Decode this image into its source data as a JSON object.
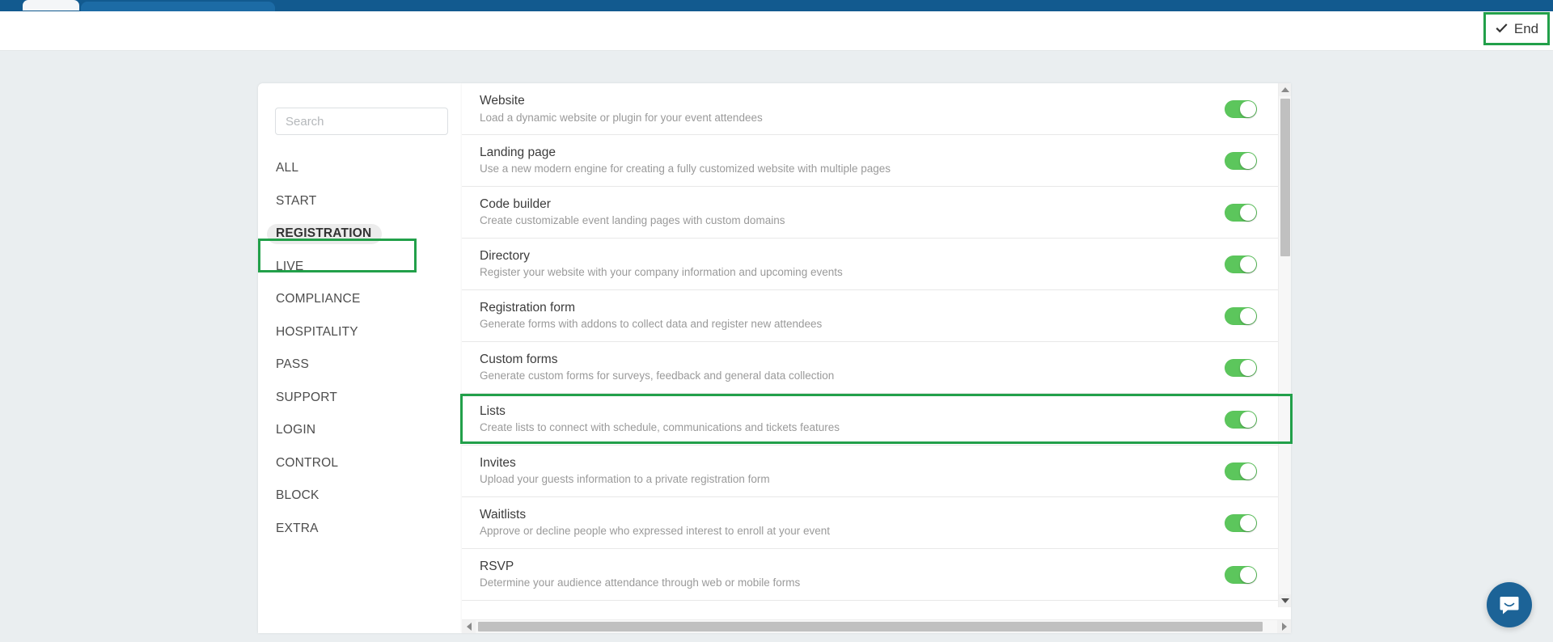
{
  "browser": {
    "chrome_color": "#125a8f",
    "active_tab_color": "#1c6ba5"
  },
  "header": {
    "end_button_label": "End",
    "end_button_icon": "check-icon",
    "highlight_color": "#22a04a"
  },
  "sidebar": {
    "search": {
      "value": "",
      "placeholder": "Search"
    },
    "items": [
      {
        "label": "ALL",
        "selected": false
      },
      {
        "label": "START",
        "selected": false
      },
      {
        "label": "REGISTRATION",
        "selected": true
      },
      {
        "label": "LIVE",
        "selected": false
      },
      {
        "label": "COMPLIANCE",
        "selected": false
      },
      {
        "label": "HOSPITALITY",
        "selected": false
      },
      {
        "label": "PASS",
        "selected": false
      },
      {
        "label": "SUPPORT",
        "selected": false
      },
      {
        "label": "LOGIN",
        "selected": false
      },
      {
        "label": "CONTROL",
        "selected": false
      },
      {
        "label": "BLOCK",
        "selected": false
      },
      {
        "label": "EXTRA",
        "selected": false
      }
    ]
  },
  "features": {
    "rows": [
      {
        "title": "Website",
        "description": "Load a dynamic website or plugin for your event attendees",
        "toggle": "on",
        "highlighted": false
      },
      {
        "title": "Landing page",
        "description": "Use a new modern engine for creating a fully customized website with multiple pages",
        "toggle": "on",
        "highlighted": false
      },
      {
        "title": "Code builder",
        "description": "Create customizable event landing pages with custom domains",
        "toggle": "on",
        "highlighted": false
      },
      {
        "title": "Directory",
        "description": "Register your website with your company information and upcoming events",
        "toggle": "on",
        "highlighted": false
      },
      {
        "title": "Registration form",
        "description": "Generate forms with addons to collect data and register new attendees",
        "toggle": "on",
        "highlighted": false
      },
      {
        "title": "Custom forms",
        "description": "Generate custom forms for surveys, feedback and general data collection",
        "toggle": "on",
        "highlighted": true
      },
      {
        "title": "Lists",
        "description": "Create lists to connect with schedule, communications and tickets features",
        "toggle": "on",
        "highlighted": false
      },
      {
        "title": "Invites",
        "description": "Upload your guests information to a private registration form",
        "toggle": "on",
        "highlighted": false
      },
      {
        "title": "Waitlists",
        "description": "Approve or decline people who expressed interest to enroll at your event",
        "toggle": "on",
        "highlighted": false
      },
      {
        "title": "RSVP",
        "description": "Determine your audience attendance through web or mobile forms",
        "toggle": "on",
        "highlighted": false
      }
    ],
    "toggle_on_color": "#5cc65c"
  },
  "scrollbars": {
    "vertical_arrow_up": "triangle-up-icon",
    "vertical_arrow_down": "triangle-down-icon",
    "horizontal_arrow_left": "triangle-left-icon",
    "horizontal_arrow_right": "triangle-right-icon"
  },
  "chat": {
    "icon": "chat-bubble-icon",
    "color": "#1c6397"
  }
}
